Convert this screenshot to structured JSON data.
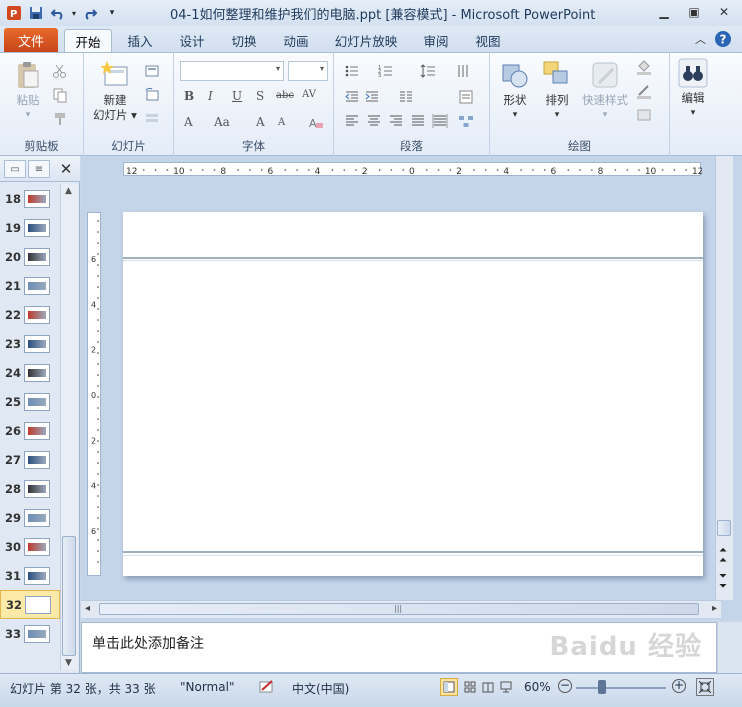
{
  "window": {
    "title": "04-1如何整理和维护我们的电脑.ppt [兼容模式]  -  Microsoft PowerPoint"
  },
  "ribbon_tabs": {
    "file": "文件",
    "items": [
      "开始",
      "插入",
      "设计",
      "切换",
      "动画",
      "幻灯片放映",
      "审阅",
      "视图"
    ],
    "active": "开始"
  },
  "ribbon": {
    "clipboard": {
      "label": "剪贴板",
      "paste": "粘贴"
    },
    "slides": {
      "label": "幻灯片",
      "new_slide_line1": "新建",
      "new_slide_line2": "幻灯片"
    },
    "font": {
      "label": "字体"
    },
    "paragraph": {
      "label": "段落"
    },
    "drawing": {
      "label": "绘图",
      "shapes": "形状",
      "arrange": "排列",
      "quick_styles": "快速样式"
    },
    "editing": {
      "label": "编辑"
    }
  },
  "slide_panel": {
    "thumbnails": [
      {
        "num": "18"
      },
      {
        "num": "19"
      },
      {
        "num": "20"
      },
      {
        "num": "21"
      },
      {
        "num": "22"
      },
      {
        "num": "23"
      },
      {
        "num": "24"
      },
      {
        "num": "25"
      },
      {
        "num": "26"
      },
      {
        "num": "27"
      },
      {
        "num": "28"
      },
      {
        "num": "29"
      },
      {
        "num": "30"
      },
      {
        "num": "31"
      },
      {
        "num": "32"
      },
      {
        "num": "33"
      }
    ],
    "selected": "32"
  },
  "rulers": {
    "horizontal_ticks": [
      "12",
      "10",
      "8",
      "6",
      "4",
      "2",
      "0",
      "2",
      "4",
      "6",
      "8",
      "10",
      "12"
    ],
    "vertical_ticks": [
      "6",
      "4",
      "2",
      "0",
      "2",
      "4",
      "6"
    ]
  },
  "notes": {
    "placeholder": "单击此处添加备注"
  },
  "status_bar": {
    "slide_info": "幻灯片 第 32 张，共 33 张",
    "theme": "\"Normal\"",
    "language": "中文(中国)",
    "zoom": "60%"
  },
  "watermark": "Baidu 经验",
  "colors": {
    "file_tab": "#d04a1b",
    "selected_thumb": "#fde9a8",
    "ribbon_bg": "#e4ecf7"
  }
}
